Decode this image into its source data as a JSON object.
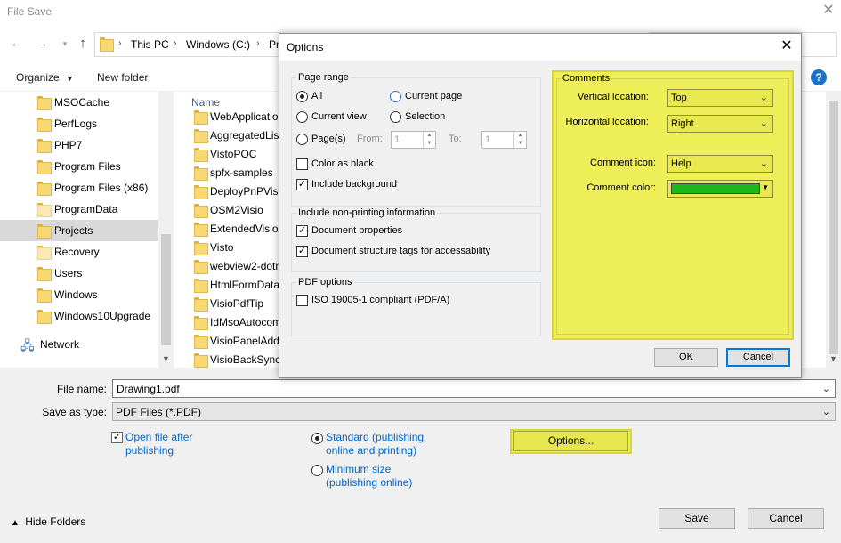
{
  "window": {
    "title": "File Save",
    "close_glyph": "✕"
  },
  "nav": {
    "back_icon": "arrow-left-icon",
    "forward_icon": "arrow-right-icon",
    "recent_icon": "chevron-down-icon",
    "up_icon": "arrow-up-icon",
    "breadcrumb": [
      "This PC",
      "Windows (C:)",
      "Pr"
    ]
  },
  "toolbar": {
    "organize_label": "Organize",
    "new_folder_label": "New folder",
    "help_label": "?"
  },
  "sidebar": {
    "items": [
      {
        "label": "MSOCache",
        "pale": false
      },
      {
        "label": "PerfLogs",
        "pale": false
      },
      {
        "label": "PHP7",
        "pale": false
      },
      {
        "label": "Program Files",
        "pale": false
      },
      {
        "label": "Program Files (x86)",
        "pale": false
      },
      {
        "label": "ProgramData",
        "pale": true
      },
      {
        "label": "Projects",
        "pale": false,
        "selected": true
      },
      {
        "label": "Recovery",
        "pale": true
      },
      {
        "label": "Users",
        "pale": false
      },
      {
        "label": "Windows",
        "pale": false
      },
      {
        "label": "Windows10Upgrade",
        "pale": false
      }
    ],
    "network_label": "Network"
  },
  "file_list": {
    "column_name": "Name",
    "items": [
      "WebApplication",
      "AggregatedList",
      "VistoPOC",
      "spfx-samples",
      "DeployPnPVisto",
      "OSM2Visio",
      "ExtendedVisioA",
      "Visto",
      "webview2-dotn",
      "HtmlFormData",
      "VisioPdfTip",
      "IdMsoAutocom",
      "VisioPanelAddi",
      "VisioBackSync"
    ]
  },
  "save_form": {
    "file_name_label": "File name:",
    "file_name_value": "Drawing1.pdf",
    "save_as_type_label": "Save as type:",
    "save_as_type_value": "PDF Files (*.PDF)",
    "open_after_label_1": "Open file after",
    "open_after_label_2": "publishing",
    "open_after_checked": true,
    "standard_label_1": "Standard (publishing",
    "standard_label_2": "online and printing)",
    "standard_selected": true,
    "minimum_label_1": "Minimum size",
    "minimum_label_2": "(publishing online)",
    "options_button": "Options...",
    "hide_folders_label": "Hide Folders",
    "save_button": "Save",
    "cancel_button": "Cancel",
    "highlight_color": "#eeee58"
  },
  "options_dialog": {
    "title": "Options",
    "page_range": {
      "label": "Page range",
      "all_label": "All",
      "current_page_label": "Current page",
      "current_view_label": "Current view",
      "selection_label": "Selection",
      "pages_label": "Page(s)",
      "from_label": "From:",
      "from_value": "1",
      "to_label": "To:",
      "to_value": "1",
      "selected": "All",
      "color_as_black_label": "Color as black",
      "color_as_black_checked": false,
      "include_background_label": "Include background",
      "include_background_checked": true
    },
    "non_printing": {
      "label": "Include non-printing information",
      "doc_props_label": "Document properties",
      "doc_props_checked": true,
      "struct_tags_label": "Document structure tags for accessability",
      "struct_tags_checked": true
    },
    "pdf_options": {
      "label": "PDF options",
      "iso_label": "ISO 19005-1 compliant (PDF/A)",
      "iso_checked": false
    },
    "comments": {
      "label": "Comments",
      "vertical_label": "Vertical location:",
      "vertical_value": "Top",
      "horizontal_label": "Horizontal location:",
      "horizontal_value": "Right",
      "icon_label": "Comment icon:",
      "icon_value": "Help",
      "color_label": "Comment color:",
      "color_value": "#1ab81a",
      "highlight_color": "#eeee58"
    },
    "ok_button": "OK",
    "cancel_button": "Cancel"
  }
}
